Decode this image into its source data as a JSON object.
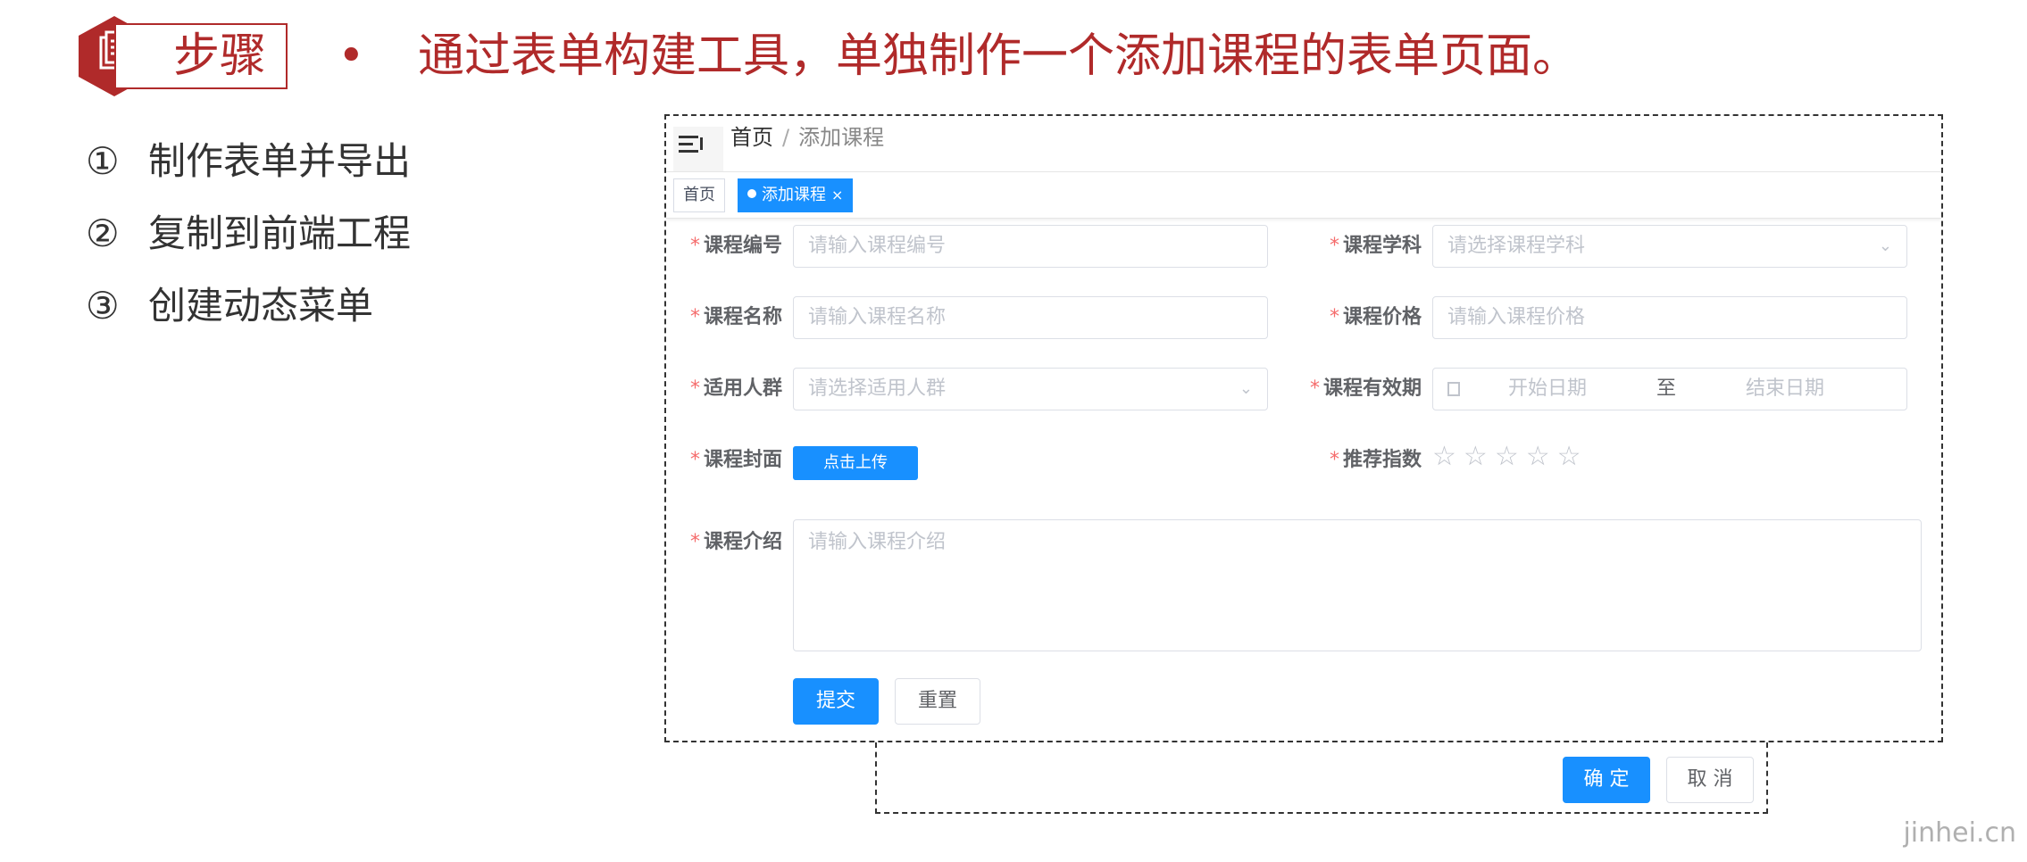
{
  "slide": {
    "tag_label": "步骤",
    "bullet": "•",
    "title": "通过表单构建工具，单独制作一个添加课程的表单页面。",
    "steps": [
      {
        "num": "①",
        "text": "制作表单并导出"
      },
      {
        "num": "②",
        "text": "复制到前端工程"
      },
      {
        "num": "③",
        "text": "创建动态菜单"
      }
    ],
    "watermark": "jinhei.cn",
    "colors": {
      "accent": "#b02a2a",
      "primary": "#1890ff",
      "required": "#f56c6c"
    }
  },
  "app": {
    "breadcrumb": {
      "home": "首页",
      "separator": "/",
      "current": "添加课程"
    },
    "tags": [
      {
        "label": "首页"
      },
      {
        "label": "添加课程",
        "close": "×"
      }
    ],
    "form": {
      "required_mark": "*",
      "fields": {
        "code": {
          "label": "课程编号",
          "placeholder": "请输入课程编号"
        },
        "subject": {
          "label": "课程学科",
          "placeholder": "请选择课程学科"
        },
        "name": {
          "label": "课程名称",
          "placeholder": "请输入课程名称"
        },
        "price": {
          "label": "课程价格",
          "placeholder": "请输入课程价格"
        },
        "audience": {
          "label": "适用人群",
          "placeholder": "请选择适用人群"
        },
        "validity": {
          "label": "课程有效期",
          "start": "开始日期",
          "to": "至",
          "end": "结束日期"
        },
        "cover": {
          "label": "课程封面",
          "button": "点击上传"
        },
        "rating": {
          "label": "推荐指数",
          "value": 0,
          "max": 5
        },
        "intro": {
          "label": "课程介绍",
          "placeholder": "请输入课程介绍"
        }
      },
      "submit": "提交",
      "reset": "重置"
    },
    "dialog": {
      "confirm": "确 定",
      "cancel": "取 消"
    },
    "icons": [
      "hamburger-icon",
      "chevron-down-icon",
      "calendar-icon",
      "star-icon",
      "close-icon",
      "document-icon"
    ]
  }
}
